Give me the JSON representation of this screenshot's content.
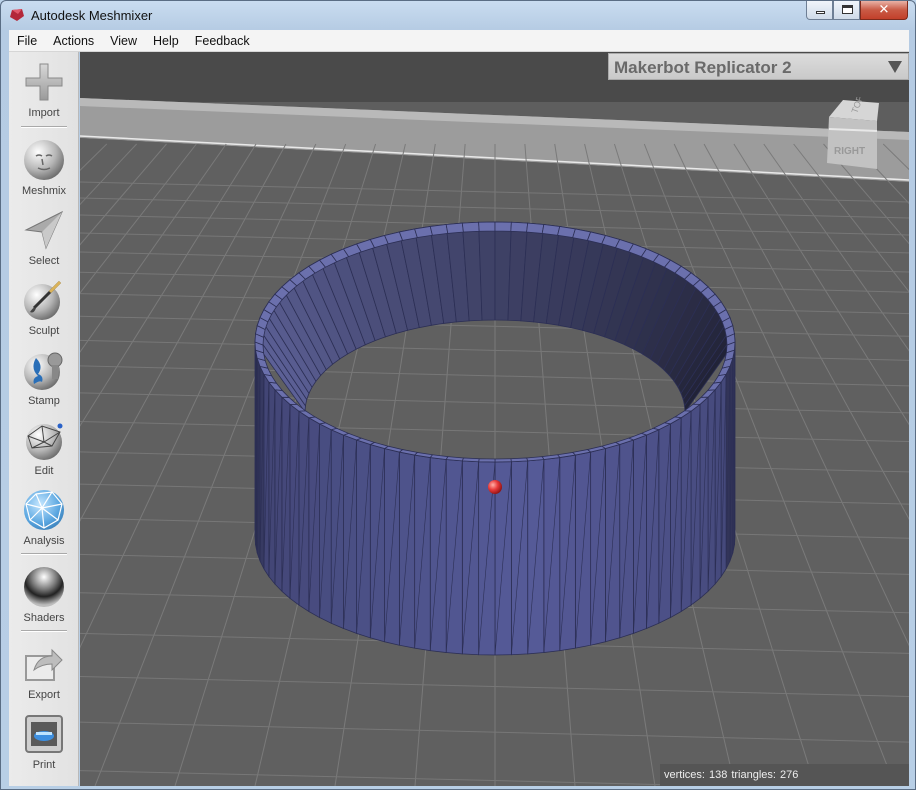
{
  "window": {
    "title": "Autodesk Meshmixer"
  },
  "menu": [
    "File",
    "Actions",
    "View",
    "Help",
    "Feedback"
  ],
  "tools": [
    {
      "name": "import",
      "label": "Import",
      "icon": "plus-icon"
    },
    {
      "name": "meshmix",
      "label": "Meshmix",
      "icon": "face-sphere-icon"
    },
    {
      "name": "select",
      "label": "Select",
      "icon": "arrow-pointer-icon"
    },
    {
      "name": "sculpt",
      "label": "Sculpt",
      "icon": "brush-sphere-icon"
    },
    {
      "name": "stamp",
      "label": "Stamp",
      "icon": "stamp-sphere-icon"
    },
    {
      "name": "edit",
      "label": "Edit",
      "icon": "wireframe-sphere-icon"
    },
    {
      "name": "analysis",
      "label": "Analysis",
      "icon": "mesh-sphere-icon"
    },
    {
      "name": "shaders",
      "label": "Shaders",
      "icon": "chrome-sphere-icon"
    },
    {
      "name": "export",
      "label": "Export",
      "icon": "export-arrow-icon"
    },
    {
      "name": "print",
      "label": "Print",
      "icon": "printer-icon"
    }
  ],
  "printer": {
    "name": "Makerbot Replicator 2"
  },
  "viewcube": {
    "top": "TOP",
    "right": "RIGHT"
  },
  "status": {
    "vertices_label": "vertices:",
    "vertices": "138",
    "triangles_label": "triangles:",
    "triangles": "276"
  },
  "colors": {
    "mesh": "#5a5f9c",
    "pivot": "#e83a3a",
    "viewport": "#5e5e5e"
  }
}
